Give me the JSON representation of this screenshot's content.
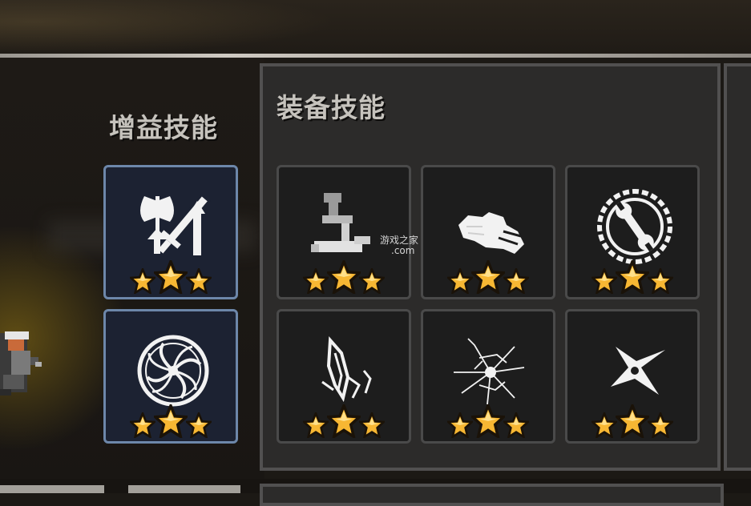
{
  "buff_skills": {
    "title": "增益技能",
    "items": [
      {
        "icon": "axe-sword-up-icon",
        "stars": 3
      },
      {
        "icon": "spiral-vortex-icon",
        "stars": 3
      }
    ]
  },
  "equip_skills": {
    "title": "装备技能",
    "items": [
      {
        "icon": "chainsaw-icon",
        "stars": 3
      },
      {
        "icon": "gauntlet-icon",
        "stars": 3
      },
      {
        "icon": "wrench-gear-icon",
        "stars": 3
      },
      {
        "icon": "crystal-claw-icon",
        "stars": 3
      },
      {
        "icon": "shattered-glass-icon",
        "stars": 3
      },
      {
        "icon": "shuriken-star-icon",
        "stars": 3
      }
    ]
  },
  "watermark": {
    "text": "游戏之家",
    "domain": ".com"
  },
  "colors": {
    "star_gold": "#f7b733",
    "buff_border": "#6d87aa",
    "panel_bg": "#2c2b2a"
  }
}
